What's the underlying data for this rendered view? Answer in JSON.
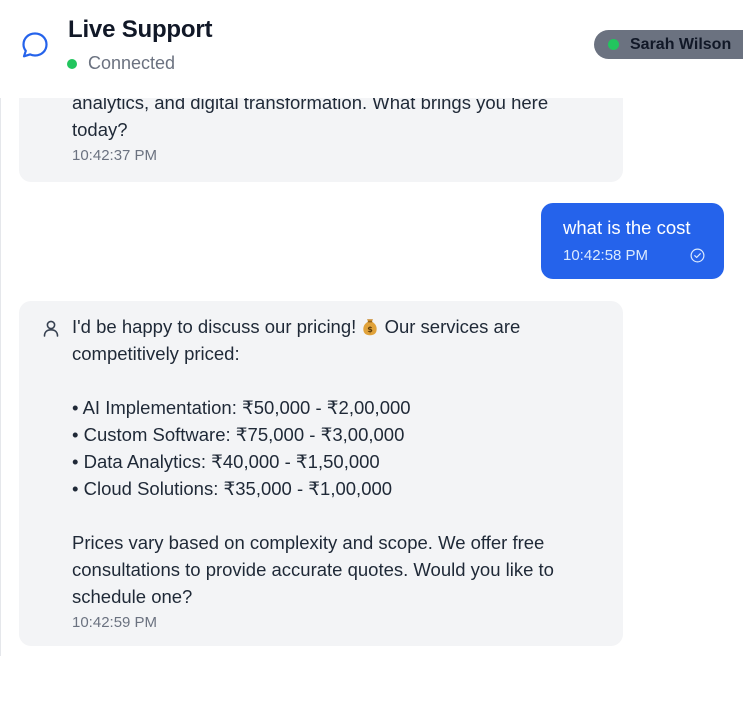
{
  "header": {
    "title": "Live Support",
    "status": "Connected",
    "agent_name": "Sarah Wilson"
  },
  "messages": [
    {
      "sender": "bot",
      "text": "analytics, and digital transformation. What brings you here today?",
      "time": "10:42:37 PM"
    },
    {
      "sender": "user",
      "text": "what is the cost",
      "time": "10:42:58 PM"
    },
    {
      "sender": "bot",
      "text_intro_before": "I'd be happy to discuss our pricing!",
      "text_intro_after": "Our services are competitively priced:",
      "emoji": "money-bag",
      "bullets": [
        "• AI Implementation: ₹50,000 - ₹2,00,000",
        "• Custom Software: ₹75,000 - ₹3,00,000",
        "• Data Analytics: ₹40,000 - ₹1,50,000",
        "• Cloud Solutions: ₹35,000 - ₹1,00,000"
      ],
      "outro": "Prices vary based on complexity and scope. We offer free consultations to provide accurate quotes. Would you like to schedule one?",
      "time": "10:42:59 PM"
    }
  ],
  "colors": {
    "accent": "#2563eb",
    "online": "#22c55e",
    "bot_bubble": "#f3f4f6",
    "agent_pill": "#6b7280"
  }
}
